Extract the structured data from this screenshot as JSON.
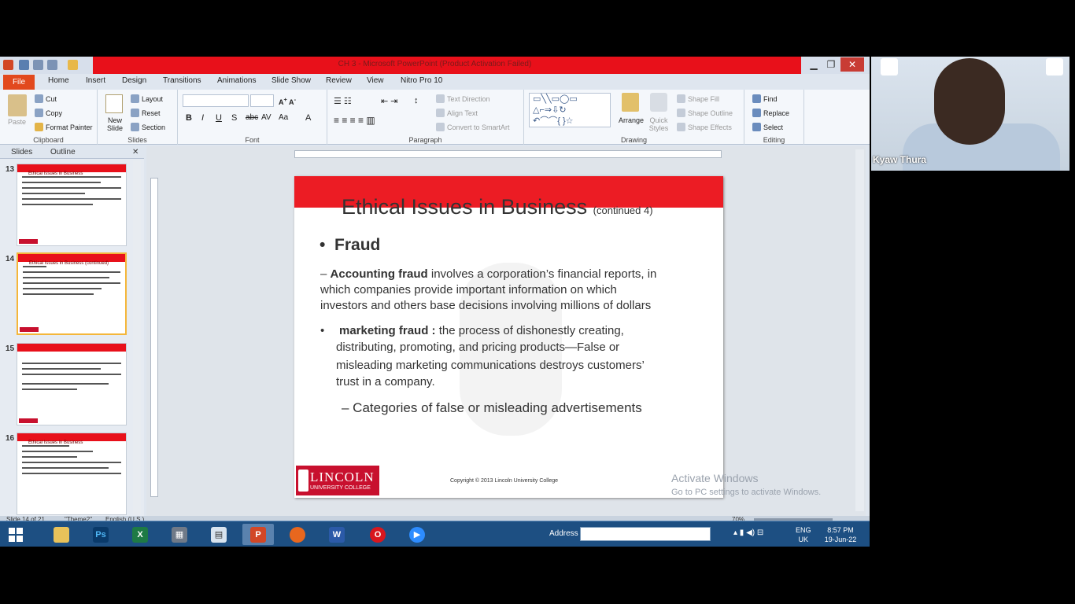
{
  "window": {
    "title": "CH 3 - Microsoft PowerPoint (Product Activation Failed)"
  },
  "ribbon_tabs": [
    "File",
    "Home",
    "Insert",
    "Design",
    "Transitions",
    "Animations",
    "Slide Show",
    "Review",
    "View",
    "Nitro Pro 10"
  ],
  "ribbon": {
    "clipboard": {
      "paste": "Paste",
      "cut": "Cut",
      "copy": "Copy",
      "format_painter": "Format Painter",
      "label": "Clipboard"
    },
    "slides": {
      "new_slide": "New Slide",
      "layout": "Layout",
      "reset": "Reset",
      "section": "Section",
      "label": "Slides"
    },
    "font": {
      "label": "Font"
    },
    "paragraph": {
      "text_direction": "Text Direction",
      "align_text": "Align Text",
      "convert": "Convert to SmartArt",
      "label": "Paragraph"
    },
    "drawing": {
      "arrange": "Arrange",
      "quick_styles": "Quick Styles",
      "shape_fill": "Shape Fill",
      "shape_outline": "Shape Outline",
      "shape_effects": "Shape Effects",
      "label": "Drawing"
    },
    "editing": {
      "find": "Find",
      "replace": "Replace",
      "select": "Select",
      "label": "Editing"
    }
  },
  "pane": {
    "tabs": [
      "Slides",
      "Outline"
    ],
    "thumbs": [
      {
        "num": "13",
        "title": "Ethical Issues in Business"
      },
      {
        "num": "14",
        "title": "Ethical Issues in Business (continued)"
      },
      {
        "num": "15",
        "title": ""
      },
      {
        "num": "16",
        "title": "Ethical Issues in Business"
      }
    ]
  },
  "slide": {
    "title": "Ethical Issues in Business",
    "title_suffix": "(continued 4)",
    "bullet1": "Fraud",
    "p1_dash": "–",
    "p1_bold": "Accounting fraud",
    "p1_line1": " involves a corporation’s financial reports, in",
    "p1_line2": "which companies provide important information on which",
    "p1_line3": "investors and others base decisions involving millions of dollars",
    "p2_bold": "marketing fraud :",
    "p2_line1": " the process of dishonestly creating,",
    "p2_line2": "distributing, promoting, and pricing products—False or",
    "p2_line3": "misleading marketing communications destroys customers’",
    "p2_line4": "trust in a company.",
    "sub": "– Categories of false or misleading advertisements",
    "logo1": "LINCOLN",
    "logo2": "UNIVERSITY COLLEGE",
    "copyright": "Copyright © 2013 Lincoln University College"
  },
  "status": {
    "slide": "Slide 14 of 21",
    "theme": "\"Theme2\"",
    "lang": "English (U.S.)",
    "zoom": "70%"
  },
  "activate": {
    "line1": "Activate Windows",
    "line2": "Go to PC settings to activate Windows."
  },
  "taskbar": {
    "address": "Address",
    "lang_top": "ENG",
    "lang_bottom": "UK",
    "time": "8:57 PM",
    "date": "19-Jun-22"
  },
  "video": {
    "name": "Kyaw Thura"
  }
}
